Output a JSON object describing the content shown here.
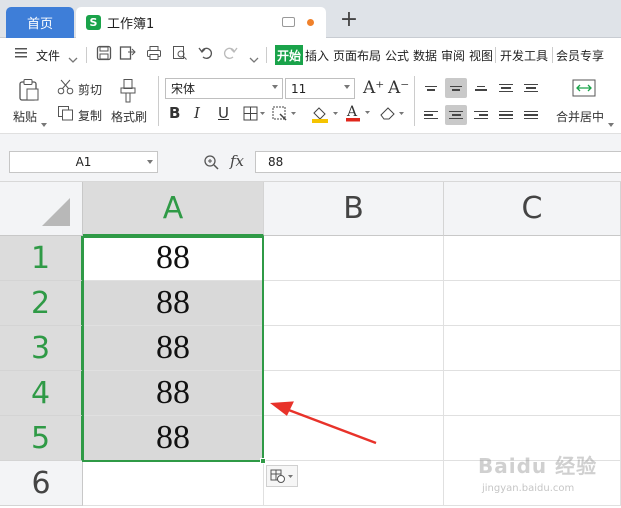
{
  "tabs": {
    "home_label": "首页",
    "workbook_label": "工作簿1",
    "workbook_icon_letter": "S",
    "add_label": "+"
  },
  "menu": {
    "file_label": "文件",
    "tabs": [
      "开始",
      "插入",
      "页面布局",
      "公式",
      "数据",
      "审阅",
      "视图",
      "开发工具",
      "会员专享"
    ]
  },
  "ribbon": {
    "paste_label": "粘贴",
    "cut_label": "剪切",
    "copy_label": "复制",
    "format_painter_label": "格式刷",
    "font_name": "宋体",
    "font_size": "11",
    "merge_label": "合并居中"
  },
  "formula_bar": {
    "cell_ref": "A1",
    "fx_label": "fx",
    "value": "88"
  },
  "sheet": {
    "columns": [
      "A",
      "B",
      "C"
    ],
    "rows": [
      "1",
      "2",
      "3",
      "4",
      "5",
      "6"
    ],
    "values": [
      "88",
      "88",
      "88",
      "88",
      "88"
    ]
  },
  "watermark": {
    "brand": "Baidu 经验",
    "url": "jingyan.baidu.com"
  },
  "colors": {
    "accent_green": "#2f9a46",
    "home_tab_blue": "#3e7ed8",
    "annotation_red": "#e8322a"
  }
}
